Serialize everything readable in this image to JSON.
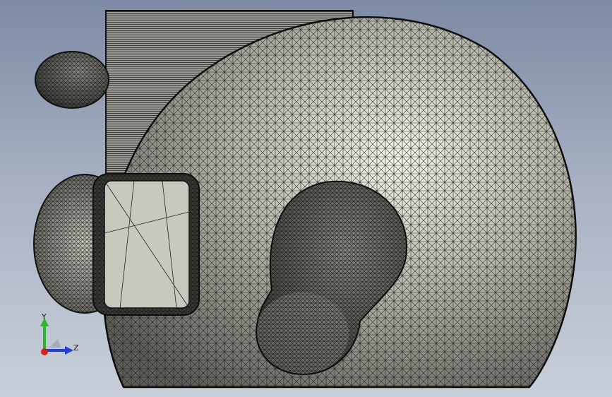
{
  "viewport": {
    "triad": {
      "y_axis_label": "Y",
      "z_axis_label": "Z",
      "y_color": "#2fb52f",
      "z_color": "#1f3fd6",
      "x_color": "#d61f1f"
    }
  }
}
